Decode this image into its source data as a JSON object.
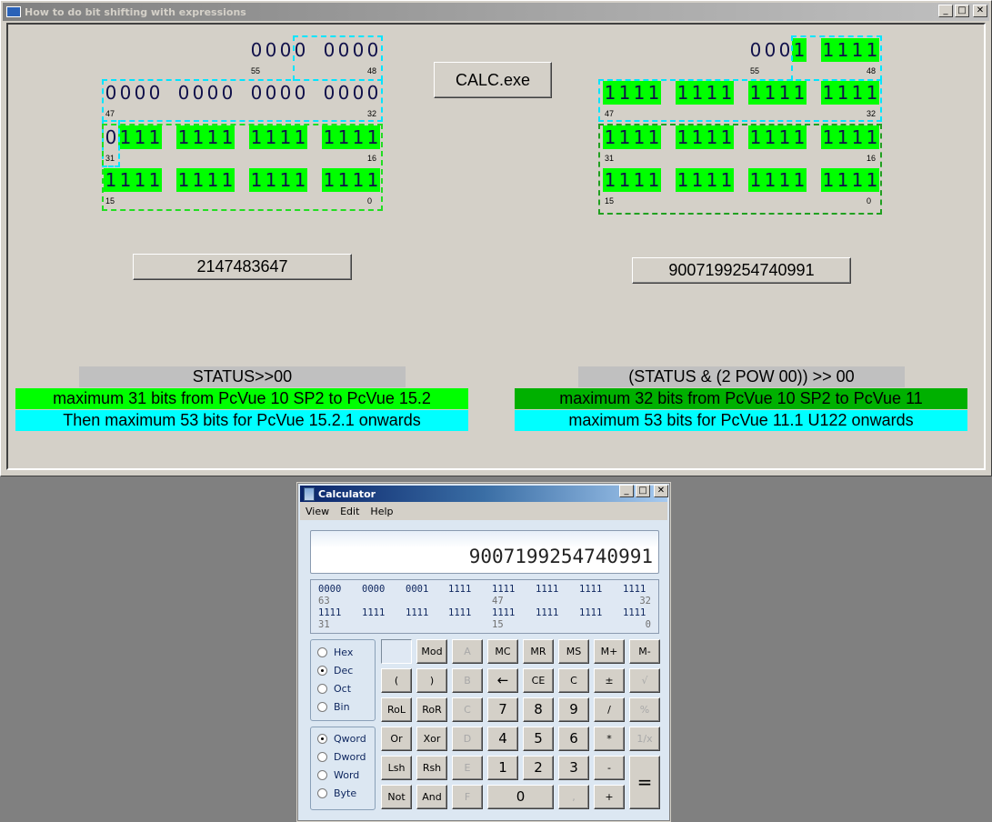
{
  "main_window": {
    "title": "How to do bit shifting with expressions",
    "controls": {
      "minimize": "_",
      "maximize": "□",
      "close": "✕"
    },
    "left_panel": {
      "rows": [
        {
          "bits": "00000000",
          "hi_index": "55",
          "lo_index": "48"
        },
        {
          "bits": "0000000000000000",
          "hi_index": "47",
          "lo_index": "32"
        },
        {
          "bits": "0111111111111111",
          "hi_index": "31",
          "lo_index": "16"
        },
        {
          "bits": "1111111111111111",
          "hi_index": "15",
          "lo_index": "0"
        }
      ],
      "value": "2147483647",
      "expression": "STATUS>>00",
      "note_green": "maximum 31 bits from PcVue 10 SP2 to PcVue 15.2",
      "note_cyan": "Then maximum 53 bits for PcVue 15.2.1 onwards"
    },
    "calc_button": "CALC.exe",
    "right_panel": {
      "rows": [
        {
          "bits": "00011111",
          "hi_index": "55",
          "lo_index": "48"
        },
        {
          "bits": "1111111111111111",
          "hi_index": "47",
          "lo_index": "32"
        },
        {
          "bits": "1111111111111111",
          "hi_index": "31",
          "lo_index": "16"
        },
        {
          "bits": "1111111111111111",
          "hi_index": "15",
          "lo_index": "0"
        }
      ],
      "value": "9007199254740991",
      "expression": "(STATUS & (2 POW 00)) >> 00",
      "note_green": "maximum 32 bits from PcVue 10 SP2 to PcVue 11",
      "note_cyan": "maximum 53 bits for PcVue 11.1 U122 onwards"
    },
    "colors": {
      "bit_on": "#00ff00",
      "note_green_left": "#00ff00",
      "note_green_right": "#00b000",
      "note_cyan": "#00ffff",
      "expression_bg": "#c0c0c0"
    }
  },
  "calculator": {
    "title": "Calculator",
    "menu": [
      "View",
      "Edit",
      "Help"
    ],
    "display": "9007199254740991",
    "binary": {
      "row1": [
        "0000",
        "0000",
        "0001",
        "1111",
        "1111",
        "1111",
        "1111",
        "1111"
      ],
      "row1_idx": [
        "63",
        "47",
        "32"
      ],
      "row2": [
        "1111",
        "1111",
        "1111",
        "1111",
        "1111",
        "1111",
        "1111",
        "1111"
      ],
      "row2_idx": [
        "31",
        "15",
        "0"
      ]
    },
    "base_radios": [
      {
        "label": "Hex",
        "selected": false
      },
      {
        "label": "Dec",
        "selected": true
      },
      {
        "label": "Oct",
        "selected": false
      },
      {
        "label": "Bin",
        "selected": false
      }
    ],
    "word_radios": [
      {
        "label": "Qword",
        "selected": true
      },
      {
        "label": "Dword",
        "selected": false
      },
      {
        "label": "Word",
        "selected": false
      },
      {
        "label": "Byte",
        "selected": false
      }
    ],
    "buttons": {
      "mod": "Mod",
      "a": "A",
      "mc": "MC",
      "mr": "MR",
      "ms": "MS",
      "mplus": "M+",
      "mminus": "M-",
      "lparen": "(",
      "rparen": ")",
      "b": "B",
      "back": "←",
      "ce": "CE",
      "c": "C",
      "pm": "±",
      "sqrt": "√",
      "rol": "RoL",
      "ror": "RoR",
      "cc": "C",
      "n7": "7",
      "n8": "8",
      "n9": "9",
      "div": "/",
      "pct": "%",
      "or": "Or",
      "xor": "Xor",
      "d": "D",
      "n4": "4",
      "n5": "5",
      "n6": "6",
      "mul": "*",
      "inv": "1/x",
      "lsh": "Lsh",
      "rsh": "Rsh",
      "e": "E",
      "n1": "1",
      "n2": "2",
      "n3": "3",
      "sub": "-",
      "eq": "=",
      "not": "Not",
      "and": "And",
      "f": "F",
      "n0": "0",
      "dot": ",",
      "add": "+"
    }
  }
}
